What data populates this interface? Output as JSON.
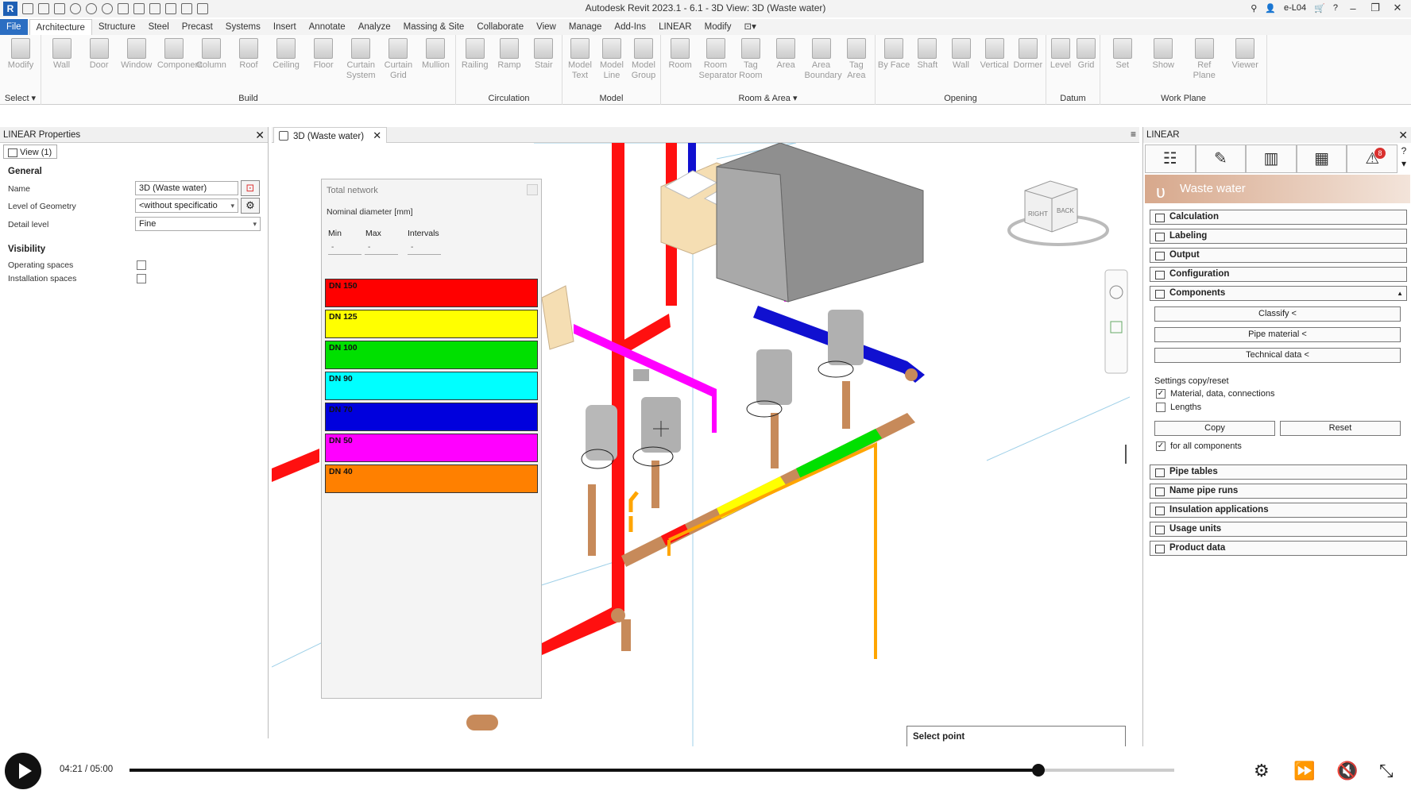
{
  "app": {
    "title": "Autodesk Revit 2023.1 - 6.1 - 3D View: 3D (Waste water)",
    "logo": "R",
    "user": "e-L04"
  },
  "ribbon_tabs": [
    "File",
    "Architecture",
    "Structure",
    "Steel",
    "Precast",
    "Systems",
    "Insert",
    "Annotate",
    "Analyze",
    "Massing & Site",
    "Collaborate",
    "View",
    "Manage",
    "Add-Ins",
    "LINEAR",
    "Modify"
  ],
  "ribbon": {
    "groups": [
      {
        "title": "Select ▾",
        "buttons": [
          "Modify"
        ]
      },
      {
        "title": "Build",
        "buttons": [
          "Wall",
          "Door",
          "Window",
          "Component",
          "Column",
          "Roof",
          "Ceiling",
          "Floor",
          "Curtain System",
          "Curtain Grid",
          "Mullion"
        ]
      },
      {
        "title": "Circulation",
        "buttons": [
          "Railing",
          "Ramp",
          "Stair"
        ]
      },
      {
        "title": "Model",
        "buttons": [
          "Model Text",
          "Model Line",
          "Model Group"
        ]
      },
      {
        "title": "Room & Area ▾",
        "buttons": [
          "Room",
          "Room Separator",
          "Tag Room",
          "Area",
          "Area Boundary",
          "Tag Area"
        ]
      },
      {
        "title": "Opening",
        "buttons": [
          "By Face",
          "Shaft",
          "Wall",
          "Vertical",
          "Dormer"
        ]
      },
      {
        "title": "Datum",
        "buttons": [
          "Level",
          "Grid"
        ]
      },
      {
        "title": "Work Plane",
        "buttons": [
          "Set",
          "Show",
          "Ref Plane",
          "Viewer"
        ]
      }
    ]
  },
  "properties": {
    "header": "LINEAR Properties",
    "view_tab": "View (1)",
    "general_label": "General",
    "name_label": "Name",
    "name_value": "3D (Waste water)",
    "log_label": "Level of Geometry",
    "log_value": "<without specificatio",
    "detail_label": "Detail level",
    "detail_value": "Fine",
    "visibility_label": "Visibility",
    "operating_label": "Operating spaces",
    "installation_label": "Installation spaces"
  },
  "view": {
    "tab_label": "3D (Waste water)"
  },
  "legend": {
    "title": "Total network",
    "subtitle": "Nominal diameter [mm]",
    "min_label": "Min",
    "max_label": "Max",
    "intervals_label": "Intervals",
    "min_value": "-",
    "max_value": "-",
    "intervals_value": "-",
    "bands": [
      {
        "label": "DN 150",
        "color": "#ff0000"
      },
      {
        "label": "DN 125",
        "color": "#ffff00"
      },
      {
        "label": "DN 100",
        "color": "#00e000"
      },
      {
        "label": "DN 90",
        "color": "#00ffff"
      },
      {
        "label": "DN 70",
        "color": "#0000dd"
      },
      {
        "label": "DN 50",
        "color": "#ff00ff"
      },
      {
        "label": "DN 40",
        "color": "#ff8000"
      }
    ]
  },
  "linear_panel": {
    "header": "LINEAR",
    "badge": "8",
    "banner": "Waste water",
    "sections_top": [
      "Calculation",
      "Labeling",
      "Output",
      "Configuration",
      "Components"
    ],
    "component_buttons": [
      "Classify  <",
      "Pipe material  <",
      "Technical data  <"
    ],
    "settings_label": "Settings copy/reset",
    "chk_material": "Material, data, connections",
    "chk_lengths": "Lengths",
    "copy_label": "Copy",
    "reset_label": "Reset",
    "chk_all": "for all components",
    "sections_bottom": [
      "Pipe tables",
      "Name pipe runs",
      "Insulation applications",
      "Usage units",
      "Product data"
    ]
  },
  "viewcube": {
    "right": "RIGHT",
    "back": "BACK"
  },
  "status": {
    "prompt": "Select point"
  },
  "player": {
    "time": "04:21 / 05:00",
    "progress": 0.87
  }
}
